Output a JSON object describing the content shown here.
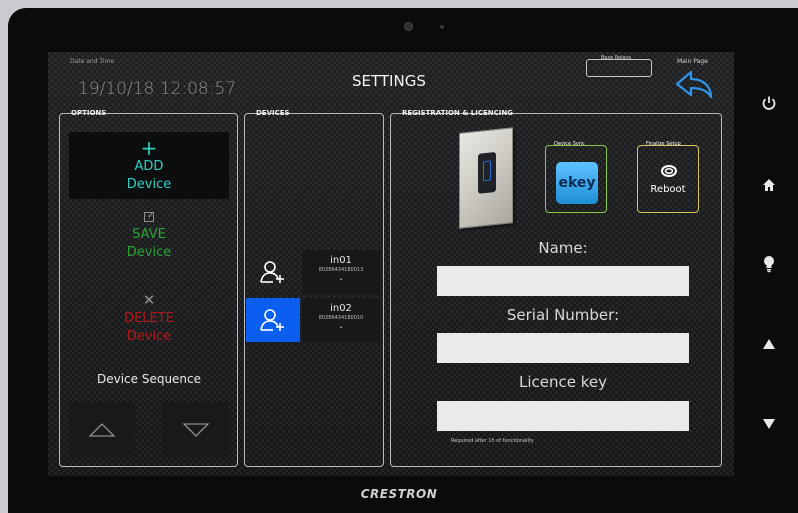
{
  "device": {
    "brand": "CRESTRON"
  },
  "header": {
    "datetime_label": "Date and Time",
    "datetime_value": "19/10/18 12:08:57",
    "title": "SETTINGS",
    "base_relays_label": "Base Relays",
    "main_page_label": "Main Page"
  },
  "options": {
    "title": "OPTIONS",
    "add": {
      "line1": "ADD",
      "line2": "Device",
      "icon": "plus-icon",
      "color": "#2ed1c4"
    },
    "save": {
      "line1": "SAVE",
      "line2": "Device",
      "icon": "checkbox-icon",
      "color": "#2aa236"
    },
    "delete": {
      "line1": "DELETE",
      "line2": "Device",
      "icon": "close-icon",
      "color": "#b41818"
    },
    "sequence_label": "Device Sequence"
  },
  "devices": {
    "title": "DEVICES",
    "items": [
      {
        "name": "in01",
        "serial": "80286434180013",
        "selected": false
      },
      {
        "name": "in02",
        "serial": "80286434180010",
        "selected": true
      }
    ],
    "selected_color": "#0a5ef0"
  },
  "registration": {
    "title": "REGISTRATION & LICENCING",
    "device_sync_label": "Device Sync",
    "device_sync_logo": "ekey",
    "finalize_label": "Finalize Setup",
    "reboot_label": "Reboot",
    "name_label": "Name:",
    "name_value": "",
    "serial_label": "Serial Number:",
    "serial_value": "",
    "licence_label": "Licence key",
    "licence_value": "",
    "note": "Required after 1h of functionality"
  },
  "hardware_buttons": [
    "power-icon",
    "home-icon",
    "lightbulb-icon",
    "arrow-up-icon",
    "arrow-down-icon"
  ],
  "colors": {
    "accent_teal": "#2ed1c4",
    "sync_border": "#8cc63f",
    "finalize_border": "#d7c65b",
    "ekey_blue": "#1f8fd6"
  }
}
